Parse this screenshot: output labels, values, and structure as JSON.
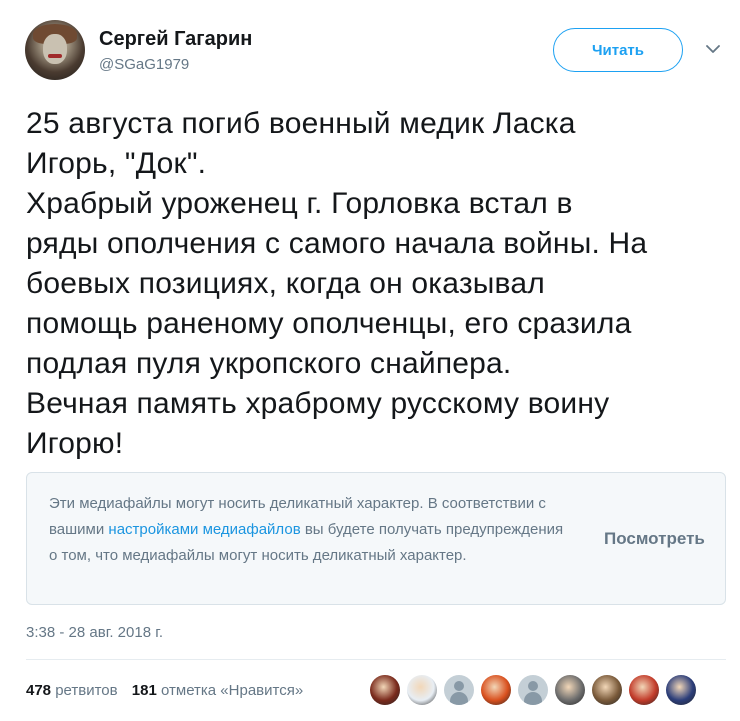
{
  "author": {
    "name": "Сергей Гагарин",
    "handle": "@SGaG1979",
    "avatar_icon": "joker-avatar-icon"
  },
  "follow_button": {
    "label": "Читать",
    "color": "#1da1f2"
  },
  "menu": {
    "icon": "chevron-down-icon"
  },
  "tweet": {
    "text": "25 августа погиб военный медик Ласка\nИгорь, \"Док\".\nХрабрый уроженец г. Горловка встал в\nряды ополчения с самого начала войны. На\nбоевых позициях, когда он оказывал\nпомощь раненому ополченцы, его сразила\nподлая пуля укропского снайпера.\nВечная память храброму русскому воину\nИгорю!"
  },
  "media_warning": {
    "text_before": "Эти медиафайлы могут носить деликатный характер. В соответствии с вашими ",
    "link": "настройками медиафайлов",
    "text_after": " вы будете получать предупреждения о том, что медиафайлы могут носить деликатный характер.",
    "view_button": "Посмотреть"
  },
  "timestamp": "3:38 - 28 авг. 2018 г.",
  "stats": {
    "retweets_count": "478",
    "retweets_label": "ретвитов",
    "likes_count": "181",
    "likes_label": "отметка «Нравится»"
  },
  "likers": [
    {
      "icon": "liker-avatar-1",
      "color": "#7a2a1c"
    },
    {
      "icon": "liker-avatar-2",
      "color": "#e8eef4"
    },
    {
      "icon": "default-avatar-icon",
      "color": "#c4cfd6"
    },
    {
      "icon": "liker-avatar-4",
      "color": "#d9501e"
    },
    {
      "icon": "default-avatar-icon",
      "color": "#c4cfd6"
    },
    {
      "icon": "liker-avatar-6",
      "color": "#6d6d6d"
    },
    {
      "icon": "liker-avatar-7",
      "color": "#7a5a3a"
    },
    {
      "icon": "liker-avatar-8",
      "color": "#c23b2a"
    },
    {
      "icon": "liker-avatar-9",
      "color": "#2c3e7a"
    }
  ]
}
